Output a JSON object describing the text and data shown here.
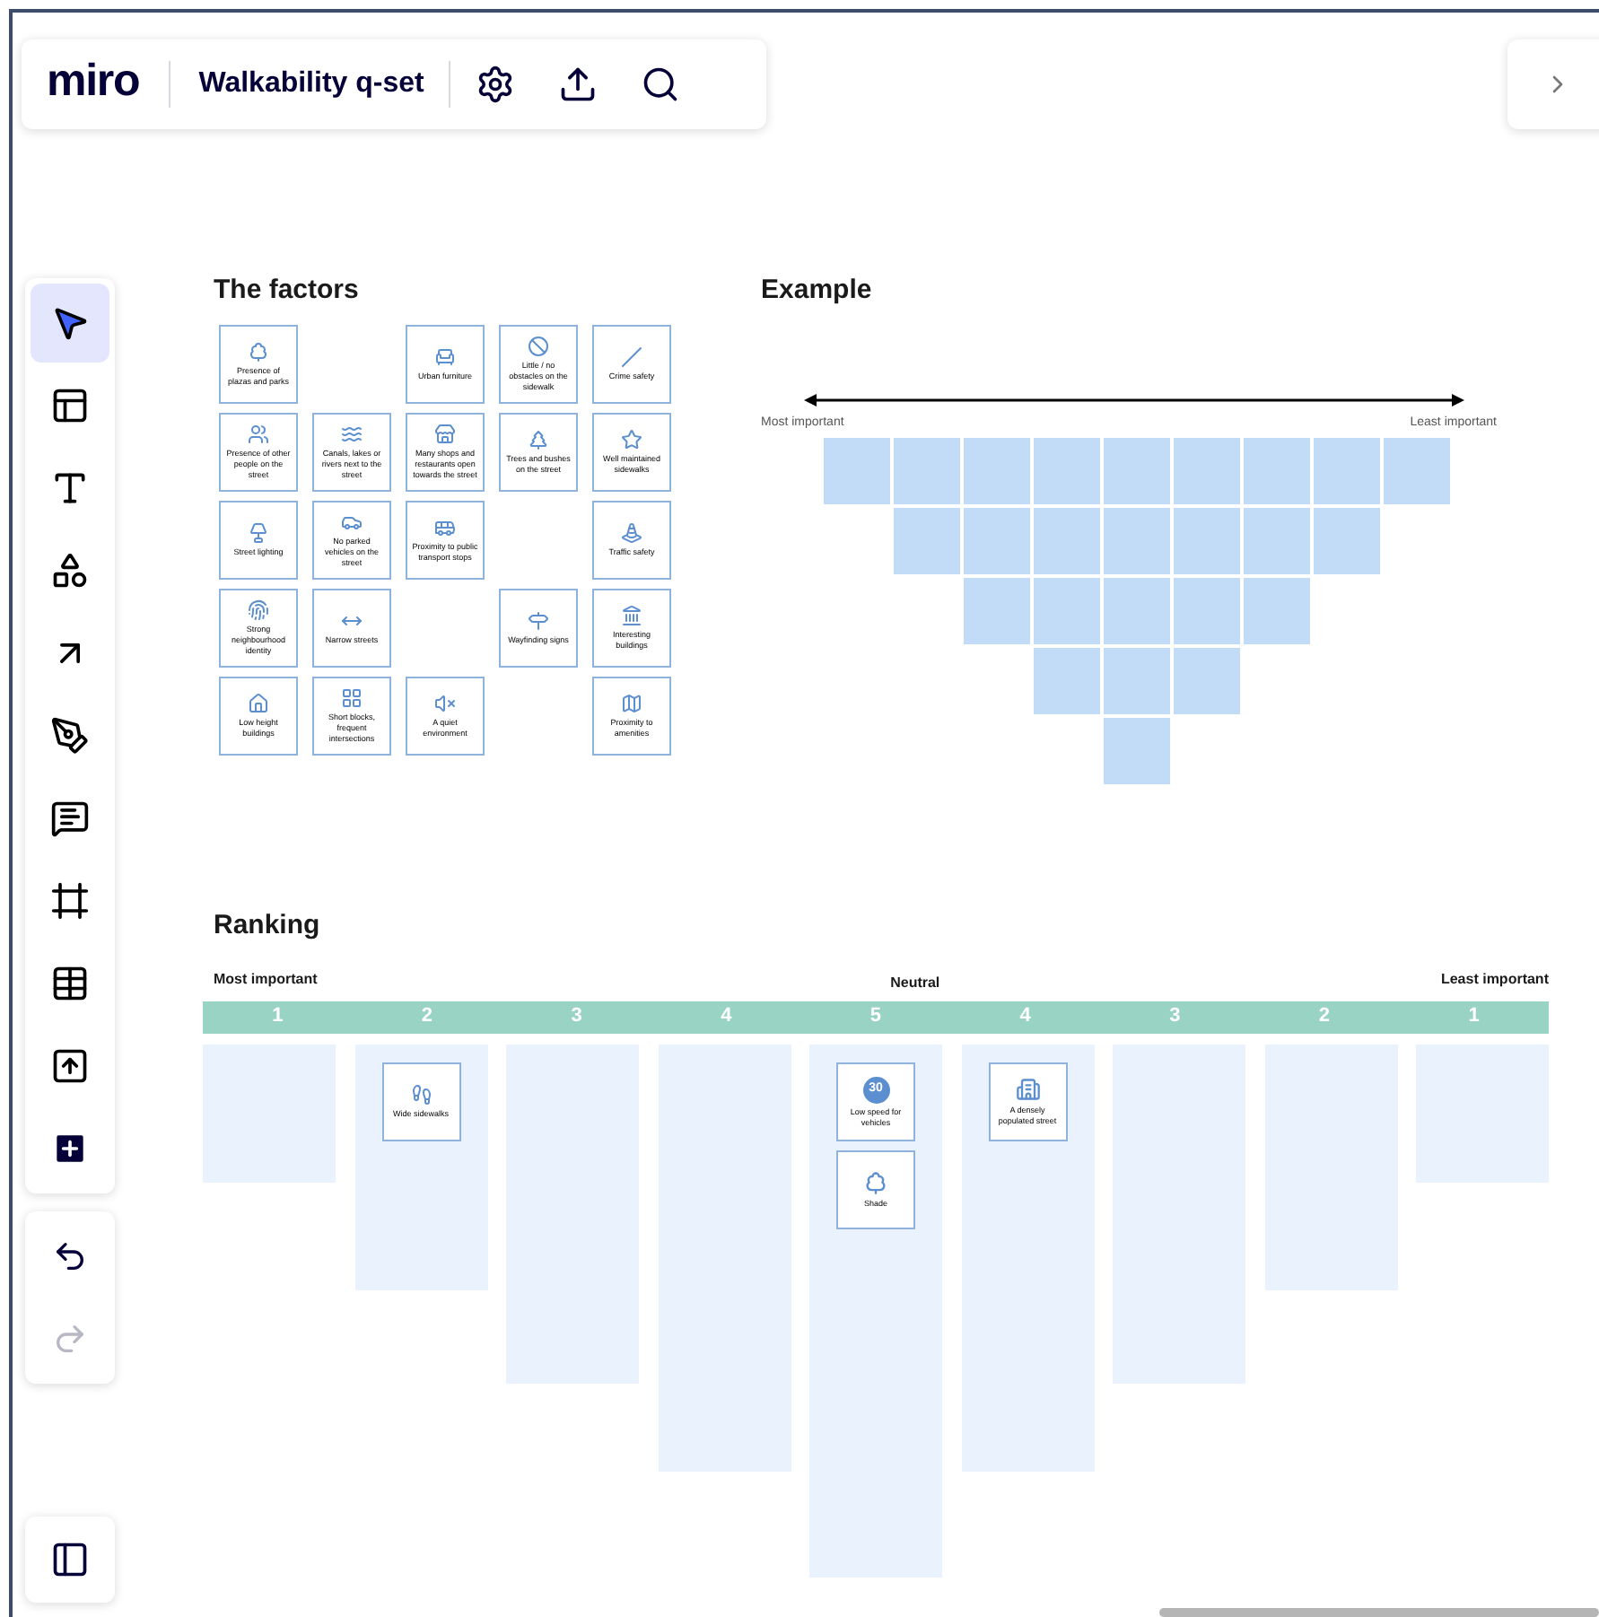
{
  "topbar": {
    "logo": "miro",
    "board_title": "Walkability q-set"
  },
  "toolbar": {
    "tools": [
      {
        "selected": true
      },
      {
        "selected": false
      },
      {
        "selected": false
      },
      {
        "selected": false
      },
      {
        "selected": false
      },
      {
        "selected": false
      },
      {
        "selected": false
      },
      {
        "selected": false
      },
      {
        "selected": false
      },
      {
        "selected": false
      },
      {
        "selected": false
      }
    ]
  },
  "history": {
    "undo": {
      "disabled": false
    },
    "redo": {
      "disabled": true
    }
  },
  "factors": {
    "title": "The factors",
    "rows": [
      [
        "Presence of plazas and parks",
        null,
        "Urban furniture",
        "Little / no obstacles on the sidewalk",
        "Crime safety"
      ],
      [
        "Presence of other people on the street",
        "Canals, lakes or rivers next to the street",
        "Many shops and restaurants open towards the street",
        "Trees and bushes on the street",
        "Well maintained sidewalks"
      ],
      [
        "Street lighting",
        "No parked vehicles on the street",
        "Proximity to public transport stops",
        null,
        "Traffic safety"
      ],
      [
        "Strong neighbourhood identity",
        "Narrow streets",
        null,
        "Wayfinding signs",
        "Interesting buildings"
      ],
      [
        "Low height buildings",
        "Short blocks, frequent intersections",
        "A quiet environment",
        null,
        "Proximity to amenities"
      ]
    ]
  },
  "example": {
    "title": "Example",
    "left_label": "Most important",
    "right_label": "Least important"
  },
  "ranking": {
    "title": "Ranking",
    "left_label": "Most important",
    "center_label": "Neutral",
    "right_label": "Least important",
    "columns": [
      {
        "number": "1"
      },
      {
        "number": "2",
        "cards": [
          {
            "kind": "sidewalk",
            "label": "Wide sidewalks"
          }
        ]
      },
      {
        "number": "3"
      },
      {
        "number": "4"
      },
      {
        "number": "5",
        "cards": [
          {
            "kind": "speed",
            "sign": "30",
            "label": "Low speed for vehicles"
          },
          {
            "kind": "shade",
            "label": "Shade"
          }
        ]
      },
      {
        "number": "4",
        "cards": [
          {
            "kind": "building",
            "label": "A densely populated street"
          }
        ]
      },
      {
        "number": "3"
      },
      {
        "number": "2"
      },
      {
        "number": "1"
      }
    ]
  }
}
